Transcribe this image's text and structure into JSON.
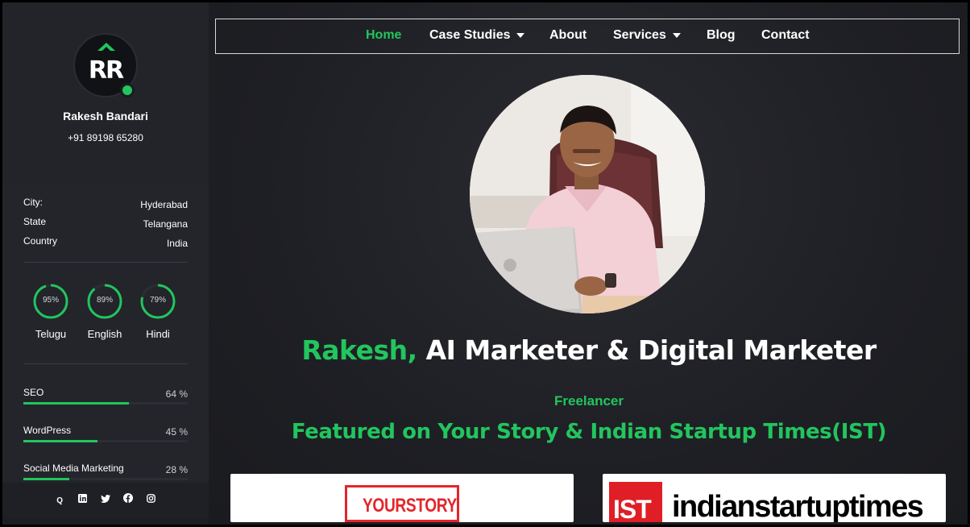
{
  "sidebar": {
    "avatar_initials": "RR",
    "name": "Rakesh Bandari",
    "phone": "+91 89198 65280",
    "info": [
      {
        "key": "City:",
        "value": "Hyderabad"
      },
      {
        "key": "State",
        "value": "Telangana"
      },
      {
        "key": "Country",
        "value": "India"
      }
    ],
    "languages": [
      {
        "name": "Telugu",
        "percent_label": "95%",
        "level": 95
      },
      {
        "name": "English",
        "percent_label": "89%",
        "level": 89
      },
      {
        "name": "Hindi",
        "percent_label": "79%",
        "level": 79
      }
    ],
    "skills": [
      {
        "name": "SEO",
        "value_label": "64 %",
        "level": 64
      },
      {
        "name": "WordPress",
        "value_label": "45 %",
        "level": 45
      },
      {
        "name": "Social Media Marketing",
        "value_label": "28 %",
        "level": 28
      }
    ],
    "social_icons": [
      "quora-icon",
      "linkedin-icon",
      "twitter-icon",
      "facebook-icon",
      "instagram-icon"
    ]
  },
  "nav": {
    "items": [
      {
        "label": "Home",
        "active": true
      },
      {
        "label": "Case Studies",
        "dropdown": true
      },
      {
        "label": "About"
      },
      {
        "label": "Services",
        "dropdown": true
      },
      {
        "label": "Blog"
      },
      {
        "label": "Contact"
      }
    ]
  },
  "hero": {
    "name_highlight": "Rakesh,",
    "title_rest": " AI Marketer & Digital Marketer",
    "subtitle": "Freelancer",
    "featured": "Featured on Your Story & Indian Startup Times(IST)"
  },
  "featured_logos": {
    "yourstory": "YOURSTORY",
    "ist_badge": "IST",
    "ist_name": "indianstartuptimes"
  },
  "colors": {
    "accent": "#22c55e",
    "background": "#1d1e23",
    "sidebar": "#23252b"
  }
}
